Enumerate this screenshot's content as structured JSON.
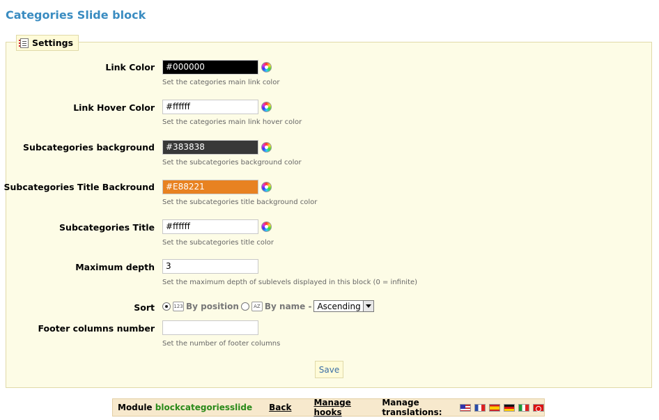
{
  "page": {
    "title": "Categories Slide block"
  },
  "fieldset": {
    "legend": "Settings"
  },
  "fields": {
    "link_color": {
      "label": "Link Color",
      "value": "#000000",
      "bg": "#000000",
      "hint": "Set the categories main link color"
    },
    "link_hover_color": {
      "label": "Link Hover Color",
      "value": "#ffffff",
      "bg": "#ffffff",
      "hint": "Set the categories main link hover color"
    },
    "subcat_background": {
      "label": "Subcategories background",
      "value": "#383838",
      "bg": "#383838",
      "hint": "Set the subcategories background color"
    },
    "subcat_title_background": {
      "label": "Subcategories Title Backround",
      "value": "#E88221",
      "bg": "#E88221",
      "hint": "Set the subcategories title background color"
    },
    "subcat_title": {
      "label": "Subcategories Title",
      "value": "#ffffff",
      "bg": "#ffffff",
      "hint": "Set the subcategories title color"
    },
    "max_depth": {
      "label": "Maximum depth",
      "value": "3",
      "hint": "Set the maximum depth of sublevels displayed in this block (0 = infinite)"
    },
    "sort": {
      "label": "Sort",
      "by_position": "By position",
      "by_name": "By name -",
      "selected": "by_position",
      "order": "Ascending"
    },
    "footer_columns": {
      "label": "Footer columns number",
      "value": "",
      "hint": "Set the number of footer columns"
    }
  },
  "save_label": "Save",
  "footer": {
    "module_prefix": "Module",
    "module_name": "blockcategoriesslide",
    "back": "Back",
    "manage_hooks": "Manage hooks",
    "manage_translations": "Manage translations:",
    "languages": [
      "us-flag-icon",
      "fr-flag-icon",
      "es-flag-icon",
      "de-flag-icon",
      "it-flag-icon",
      "tr-flag-icon"
    ]
  },
  "colors": {
    "title": "#3a8cc1",
    "panel_bg": "#fdfce6",
    "footer_bg": "#f7e9cd",
    "module_name": "#2a8a1a"
  }
}
